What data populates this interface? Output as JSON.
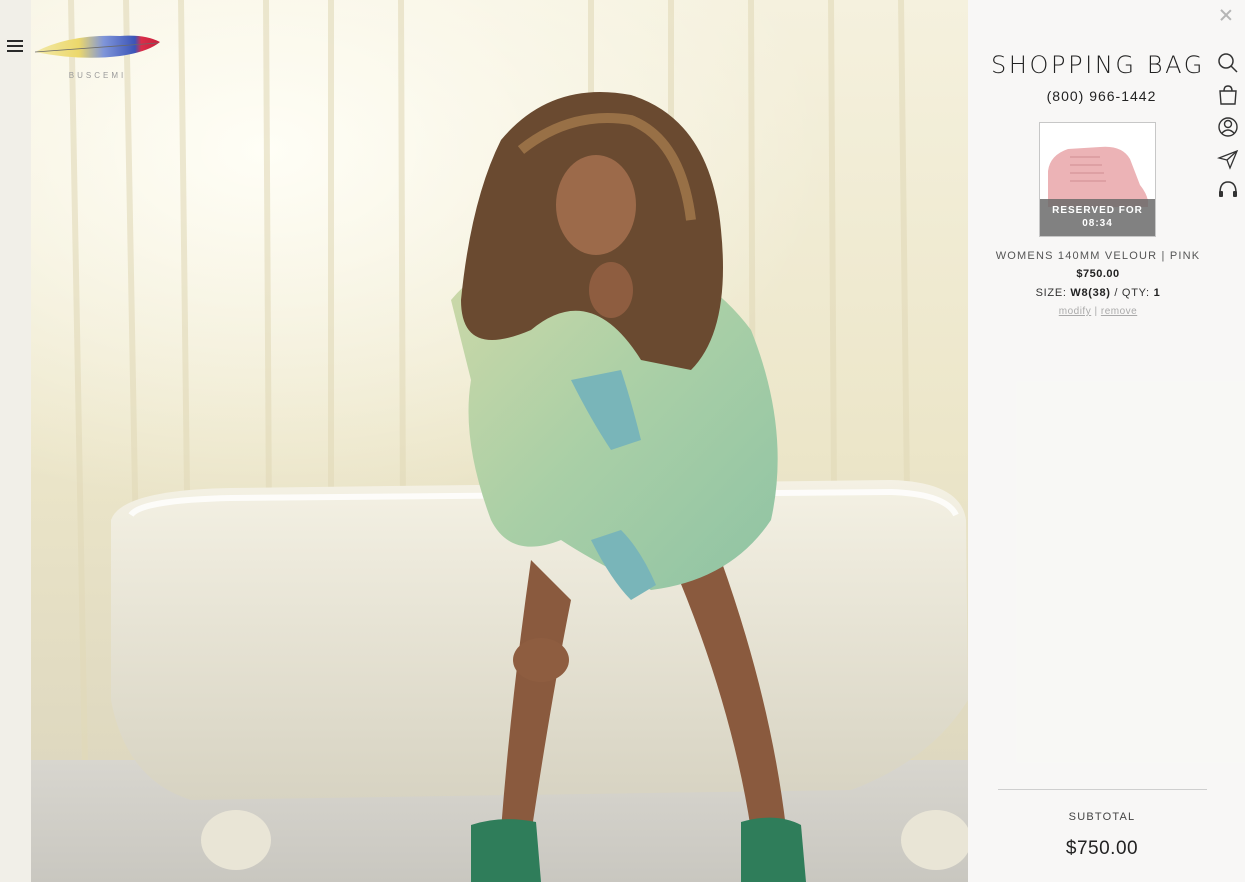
{
  "nav": {
    "menu_icon": "hamburger-menu-icon"
  },
  "brand": {
    "logo_text": "BUSCEMI",
    "logo_icon": "feather-icon"
  },
  "hero": {
    "description_icon": "hero-photo"
  },
  "bag": {
    "title": "SHOPPING BAG",
    "phone": "(800) 966-1442",
    "close_icon": "close-icon",
    "items": [
      {
        "reserved_line1": "RESERVED FOR",
        "reserved_line2": "08:34",
        "name": "WOMENS 140MM VELOUR | PINK",
        "price": "$750.00",
        "size_label": "SIZE:",
        "size_value": "W8(38)",
        "qty_label": "/ QTY:",
        "qty_value": "1",
        "modify_label": "modify",
        "separator": "|",
        "remove_label": "remove"
      }
    ],
    "subtotal_label": "SUBTOTAL",
    "subtotal_value": "$750.00"
  },
  "side_icons": [
    "search-icon",
    "bag-icon",
    "account-icon",
    "send-icon",
    "headphones-icon"
  ],
  "colors": {
    "panel_bg": "#f8f8f6",
    "accent_pink": "#e8a7ad",
    "text_dark": "#222222"
  }
}
